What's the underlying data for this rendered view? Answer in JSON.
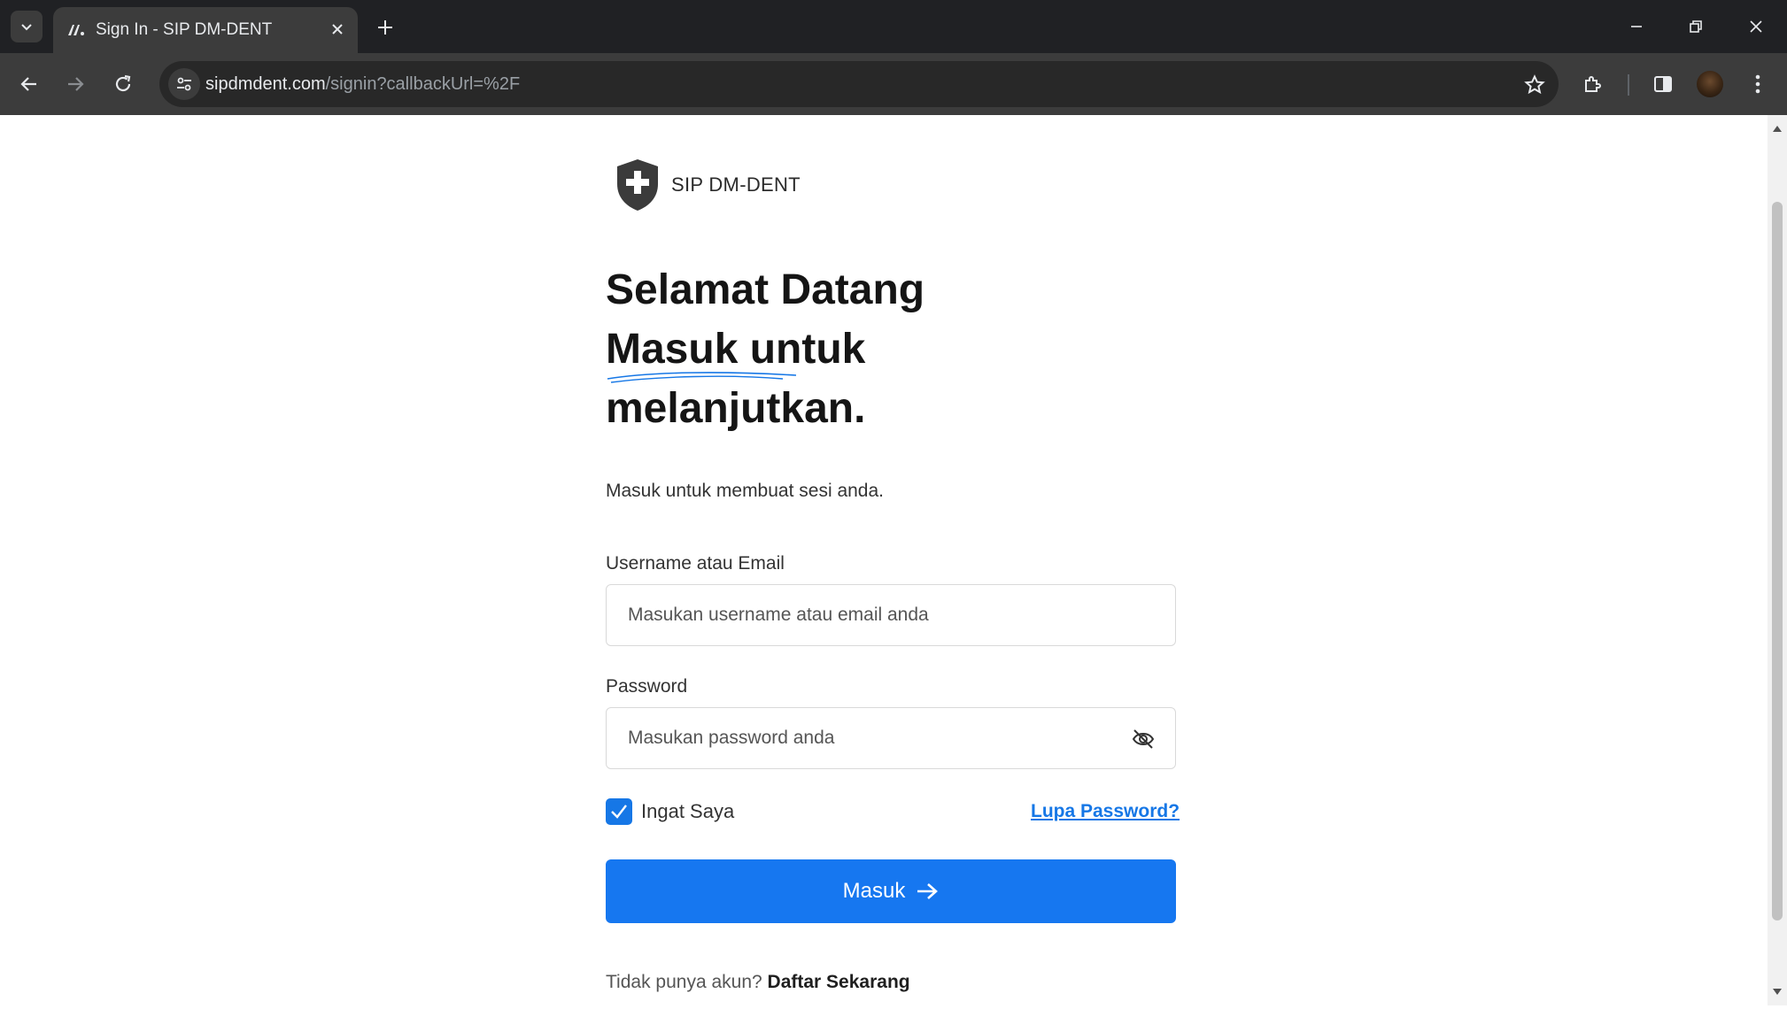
{
  "browser": {
    "tab_title": "Sign In - SIP DM-DENT",
    "url_domain": "sipdmdent.com",
    "url_path": "/signin?callbackUrl=%2F"
  },
  "page": {
    "brand_name": "SIP DM-DENT",
    "heading_line1": "Selamat Datang",
    "heading_line2": "Masuk untuk",
    "heading_line3": "melanjutkan.",
    "subtitle": "Masuk untuk membuat sesi anda.",
    "username_label": "Username atau Email",
    "username_placeholder": "Masukan username atau email anda",
    "password_label": "Password",
    "password_placeholder": "Masukan password anda",
    "remember_label": "Ingat Saya",
    "forgot_link": "Lupa Password?",
    "submit_label": "Masuk",
    "signup_prompt": "Tidak punya akun?",
    "signup_link": "Daftar Sekarang"
  },
  "colors": {
    "primary": "#1677f0",
    "link": "#1677e6",
    "chrome_dark": "#202124"
  }
}
